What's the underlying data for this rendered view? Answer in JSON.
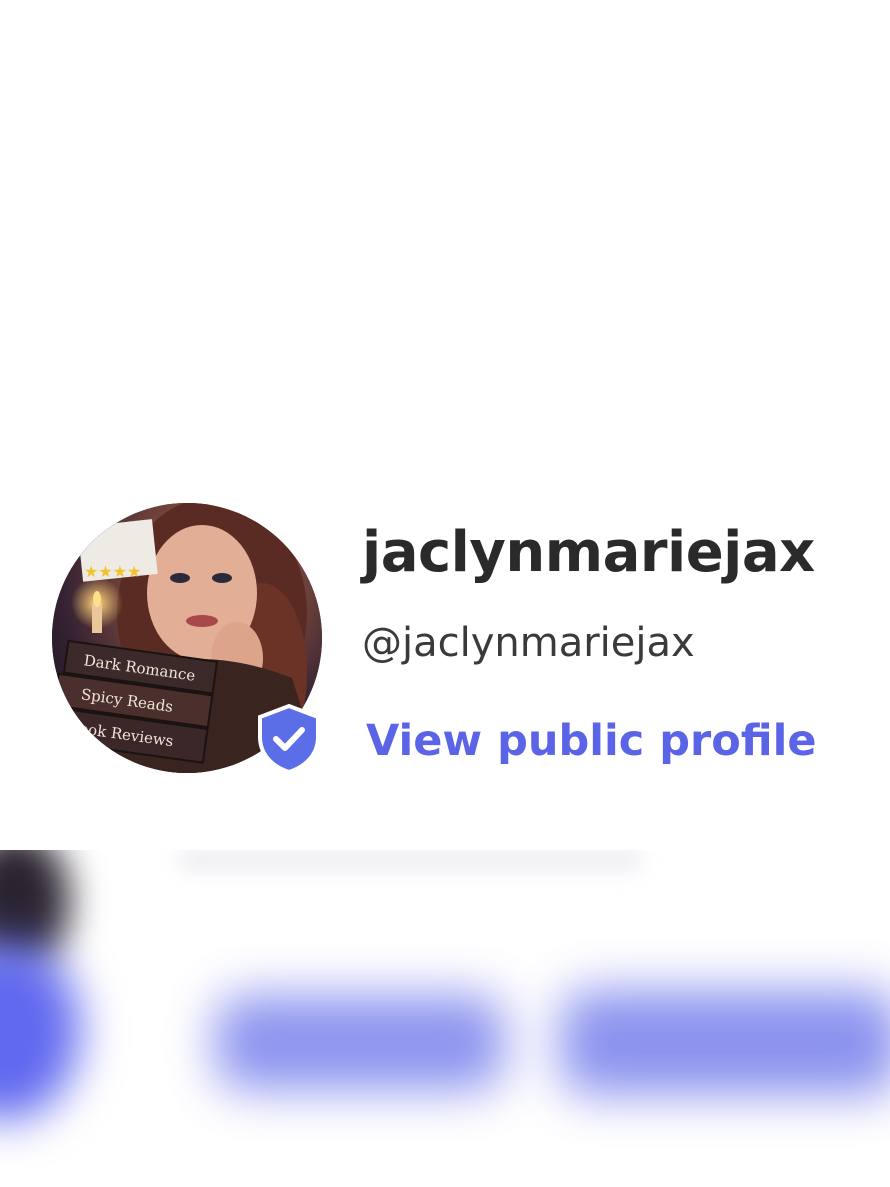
{
  "profile": {
    "username": "jaclynmariejax",
    "handle": "@jaclynmariejax",
    "view_public_profile_label": "View public profile",
    "verified": true,
    "avatar_text": {
      "book_1": "Dark Romance",
      "book_2": "Spicy Reads",
      "book_3": "Book Reviews"
    }
  },
  "colors": {
    "link": "#5b63e6",
    "badge": "#5b6ee8",
    "username": "#2a2a2a",
    "handle": "#3a3a3a"
  },
  "icons": {
    "verified": "verified-shield-icon"
  }
}
